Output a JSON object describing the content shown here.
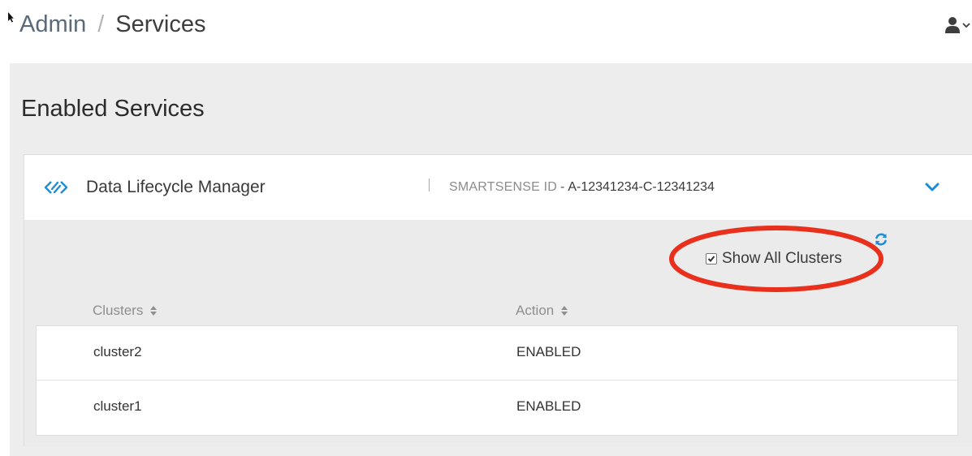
{
  "breadcrumb": {
    "parent": "Admin",
    "separator": "/",
    "current": "Services"
  },
  "user_menu": {
    "icon": "user-icon",
    "caret": "caret-down-icon"
  },
  "panel": {
    "title": "Enabled Services"
  },
  "service": {
    "icon": "dlm-icon",
    "name": "Data Lifecycle Manager",
    "smartsense_label": "SMARTSENSE ID",
    "smartsense_dash": "-",
    "smartsense_id": "A-12341234-C-12341234",
    "expand_icon": "chevron-down-icon"
  },
  "controls": {
    "refresh_icon": "refresh-icon",
    "show_all_label": "Show All Clusters",
    "show_all_checked": true
  },
  "table": {
    "columns": [
      "Clusters",
      "Action"
    ],
    "rows": [
      {
        "cluster": "cluster2",
        "action": "ENABLED"
      },
      {
        "cluster": "cluster1",
        "action": "ENABLED"
      }
    ]
  },
  "colors": {
    "accent": "#1f8dd6",
    "highlight": "#e8301c",
    "panel_bg": "#ededed"
  }
}
